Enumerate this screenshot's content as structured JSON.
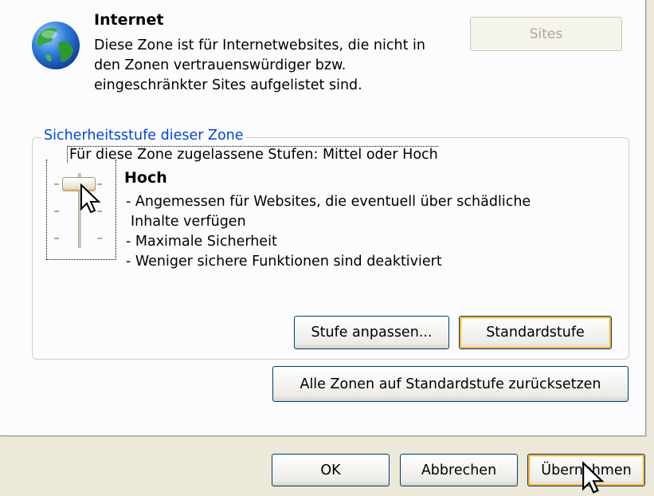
{
  "zone": {
    "title": "Internet",
    "description": [
      "Diese Zone ist für Internetwebsites, die nicht in",
      "den Zonen vertrauenswürdiger bzw.",
      "eingeschränkter Sites aufgelistet sind."
    ],
    "sites_button": "Sites",
    "icon": "globe-icon"
  },
  "security_level": {
    "group_title": "Sicherheitsstufe dieser Zone",
    "allowed_levels": "Für diese Zone zugelassene Stufen: Mittel oder Hoch",
    "level_name": "Hoch",
    "details": [
      "- Angemessen für Websites, die eventuell über schädliche",
      "Inhalte verfügen",
      "- Maximale Sicherheit",
      "- Weniger sichere Funktionen sind deaktiviert"
    ],
    "slider_position": "top",
    "custom_level_button": "Stufe anpassen...",
    "default_level_button": "Standardstufe"
  },
  "reset_all_button": "Alle Zonen auf Standardstufe zurücksetzen",
  "footer": {
    "ok": "OK",
    "cancel": "Abbrechen",
    "apply": "Übernehmen"
  },
  "colors": {
    "group_title": "#0046d5",
    "focus_highlight": "#f8b636"
  }
}
